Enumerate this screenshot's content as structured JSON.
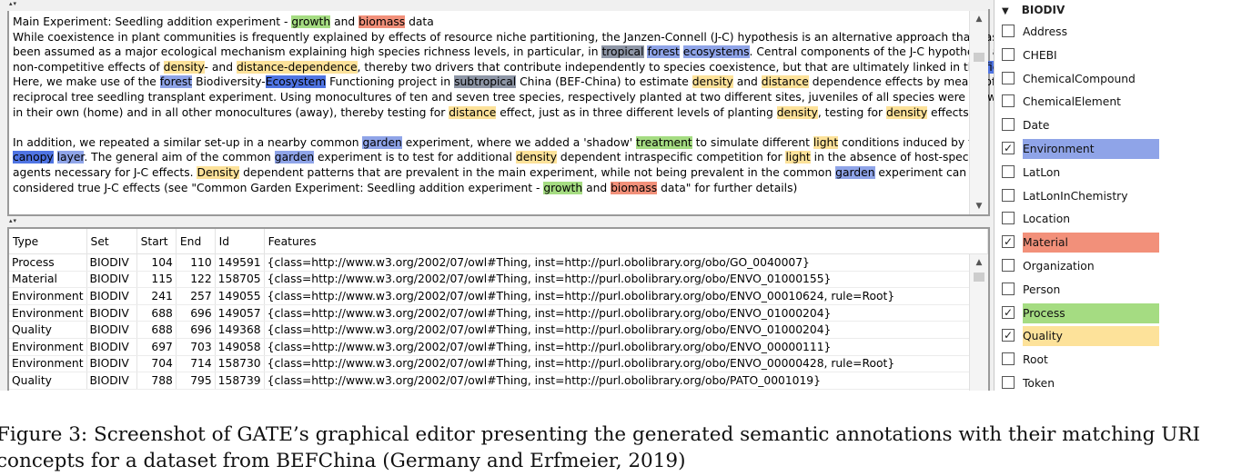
{
  "text_pane": {
    "lines": [
      [
        {
          "t": "Main Experiment: Seedling addition experiment - "
        },
        {
          "t": "growth",
          "h": "g"
        },
        {
          "t": " and "
        },
        {
          "t": "biomass",
          "h": "r"
        },
        {
          "t": " data"
        }
      ],
      [
        {
          "t": "While coexistence in plant communities is frequently explained by effects of resource niche partitioning, the Janzen-Connell (J-C) hypothesis is an alternative approach that has"
        }
      ],
      [
        {
          "t": "been assumed as a major ecological mechanism explaining high species richness levels, in particular, in "
        },
        {
          "t": "tropical",
          "h": "gr"
        },
        {
          "t": " "
        },
        {
          "t": "forest",
          "h": "b"
        },
        {
          "t": " "
        },
        {
          "t": "ecosystems",
          "h": "b"
        },
        {
          "t": ". Central components of the J-C hypothesis are"
        }
      ],
      [
        {
          "t": "non-competitive effects of "
        },
        {
          "t": "density",
          "h": "y"
        },
        {
          "t": "- and "
        },
        {
          "t": "distance-dependence",
          "h": "y"
        },
        {
          "t": ", thereby two drivers that contribute independently to species coexistence, but that are ultimately linked in the "
        },
        {
          "t": "field",
          "h": "bd"
        },
        {
          "t": "."
        }
      ],
      [
        {
          "t": "Here, we make use of the "
        },
        {
          "t": "forest",
          "h": "b"
        },
        {
          "t": " Biodiversity-"
        },
        {
          "t": "Ecosystem",
          "h": "bd"
        },
        {
          "t": " Functioning project in "
        },
        {
          "t": "subtropical",
          "h": "gr"
        },
        {
          "t": " China (BEF-China) to estimate "
        },
        {
          "t": "density",
          "h": "y"
        },
        {
          "t": " and "
        },
        {
          "t": "distance",
          "h": "y"
        },
        {
          "t": " dependence effects by means of a"
        }
      ],
      [
        {
          "t": "reciprocal tree seedling transplant experiment. Using monocultures of ten and seven tree species, respectively planted at two different sites, juveniles of all species were grown"
        }
      ],
      [
        {
          "t": "in their own (home) and in all other monocultures (away), thereby testing for "
        },
        {
          "t": "distance",
          "h": "y"
        },
        {
          "t": " effect, just as in three different levels of planting "
        },
        {
          "t": "density",
          "h": "y"
        },
        {
          "t": ", testing for "
        },
        {
          "t": "density",
          "h": "y"
        },
        {
          "t": " effects."
        }
      ],
      [],
      [
        {
          "t": "In addition, we repeated a similar set-up in a nearby common "
        },
        {
          "t": "garden",
          "h": "b"
        },
        {
          "t": " experiment, where we added a 'shadow' "
        },
        {
          "t": "treatment",
          "h": "g"
        },
        {
          "t": " to simulate different "
        },
        {
          "t": "light",
          "h": "y"
        },
        {
          "t": " conditions induced by the"
        }
      ],
      [
        {
          "t": "canopy",
          "h": "bd"
        },
        {
          "t": " "
        },
        {
          "t": "layer",
          "h": "b"
        },
        {
          "t": ". The general aim of the common "
        },
        {
          "t": "garden",
          "h": "b"
        },
        {
          "t": " experiment is to test for additional "
        },
        {
          "t": "density",
          "h": "y"
        },
        {
          "t": " dependent intraspecific competition for "
        },
        {
          "t": "light",
          "h": "y"
        },
        {
          "t": " in the absence of host-specific"
        }
      ],
      [
        {
          "t": "agents necessary for J-C effects. "
        },
        {
          "t": "Density",
          "h": "y"
        },
        {
          "t": " dependent patterns that are prevalent in the main experiment, while not being prevalent in the common "
        },
        {
          "t": "garden",
          "h": "b"
        },
        {
          "t": " experiment can be"
        }
      ],
      [
        {
          "t": "considered true J-C effects (see \"Common Garden Experiment: Seedling addition experiment - "
        },
        {
          "t": "growth",
          "h": "g"
        },
        {
          "t": " and "
        },
        {
          "t": "biomass",
          "h": "r"
        },
        {
          "t": " data\" for further details)"
        }
      ]
    ]
  },
  "table": {
    "headers": [
      "Type",
      "Set",
      "Start",
      "End",
      "Id",
      "Features"
    ],
    "rows": [
      [
        "Process",
        "BIODIV",
        "104",
        "110",
        "149591",
        "{class=http://www.w3.org/2002/07/owl#Thing, inst=http://purl.obolibrary.org/obo/GO_0040007}"
      ],
      [
        "Material",
        "BIODIV",
        "115",
        "122",
        "158705",
        "{class=http://www.w3.org/2002/07/owl#Thing, inst=http://purl.obolibrary.org/obo/ENVO_01000155}"
      ],
      [
        "Environment",
        "BIODIV",
        "241",
        "257",
        "149055",
        "{class=http://www.w3.org/2002/07/owl#Thing, inst=http://purl.obolibrary.org/obo/ENVO_00010624, rule=Root}"
      ],
      [
        "Environment",
        "BIODIV",
        "688",
        "696",
        "149057",
        "{class=http://www.w3.org/2002/07/owl#Thing, inst=http://purl.obolibrary.org/obo/ENVO_01000204}"
      ],
      [
        "Quality",
        "BIODIV",
        "688",
        "696",
        "149368",
        "{class=http://www.w3.org/2002/07/owl#Thing, inst=http://purl.obolibrary.org/obo/ENVO_01000204}"
      ],
      [
        "Environment",
        "BIODIV",
        "697",
        "703",
        "149058",
        "{class=http://www.w3.org/2002/07/owl#Thing, inst=http://purl.obolibrary.org/obo/ENVO_00000111}"
      ],
      [
        "Environment",
        "BIODIV",
        "704",
        "714",
        "158730",
        "{class=http://www.w3.org/2002/07/owl#Thing, inst=http://purl.obolibrary.org/obo/ENVO_00000428, rule=Root}"
      ],
      [
        "Quality",
        "BIODIV",
        "788",
        "795",
        "158739",
        "{class=http://www.w3.org/2002/07/owl#Thing, inst=http://purl.obolibrary.org/obo/PATO_0001019}"
      ]
    ]
  },
  "annotation_sets": {
    "header": "BIODIV",
    "expand_icon": "triangle-down-icon",
    "items": [
      {
        "label": "Address",
        "checked": false
      },
      {
        "label": "CHEBI",
        "checked": false
      },
      {
        "label": "ChemicalCompound",
        "checked": false
      },
      {
        "label": "ChemicalElement",
        "checked": false
      },
      {
        "label": "Date",
        "checked": false
      },
      {
        "label": "Environment",
        "checked": true,
        "color": "#8fa4e8"
      },
      {
        "label": "LatLon",
        "checked": false
      },
      {
        "label": "LatLonInChemistry",
        "checked": false
      },
      {
        "label": "Location",
        "checked": false
      },
      {
        "label": "Material",
        "checked": true,
        "color": "#f2907a"
      },
      {
        "label": "Organization",
        "checked": false
      },
      {
        "label": "Person",
        "checked": false
      },
      {
        "label": "Process",
        "checked": true,
        "color": "#a5dc82"
      },
      {
        "label": "Quality",
        "checked": true,
        "color": "#fde29a"
      },
      {
        "label": "Root",
        "checked": false
      },
      {
        "label": "Token",
        "checked": false
      }
    ]
  },
  "caption": {
    "line1": "Figure 3: Screenshot of GATE’s graphical editor presenting the generated semantic annotations with their matching URI",
    "line2": "concepts for a dataset from BEFChina (Germany and Erfmeier, 2019)"
  },
  "colors": {
    "growth_process": "#a5dc82",
    "biomass_material": "#f2907a",
    "quality": "#fde29a",
    "environment": "#8fa4e8",
    "environment_dark": "#4f74e3",
    "tropical_gray": "#8e96a6"
  }
}
